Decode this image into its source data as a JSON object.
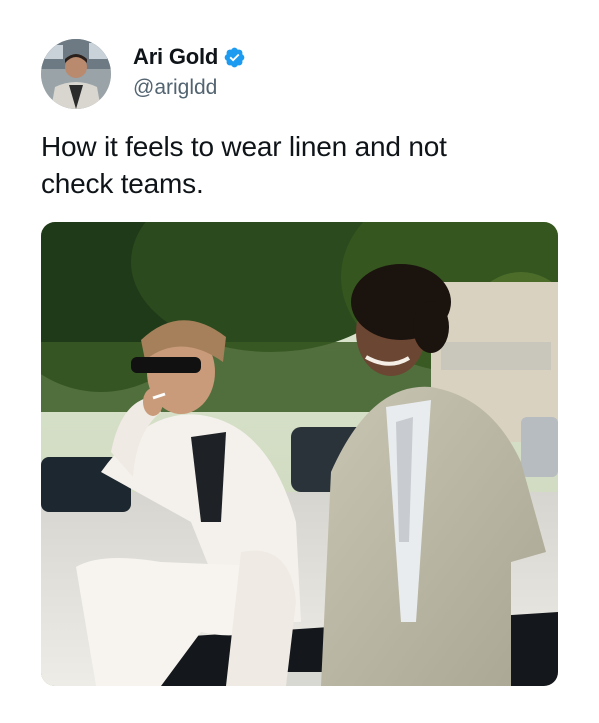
{
  "tweet": {
    "author": {
      "display_name": "Ari Gold",
      "handle": "@arigldd",
      "verified": true,
      "verified_icon": "verified-badge-icon",
      "verified_color": "#1d9bf0",
      "avatar": "profile photo of man in suit"
    },
    "text_line1": "How it feels to wear linen and not",
    "text_line2": "check teams.",
    "media": {
      "type": "photo"
    }
  }
}
